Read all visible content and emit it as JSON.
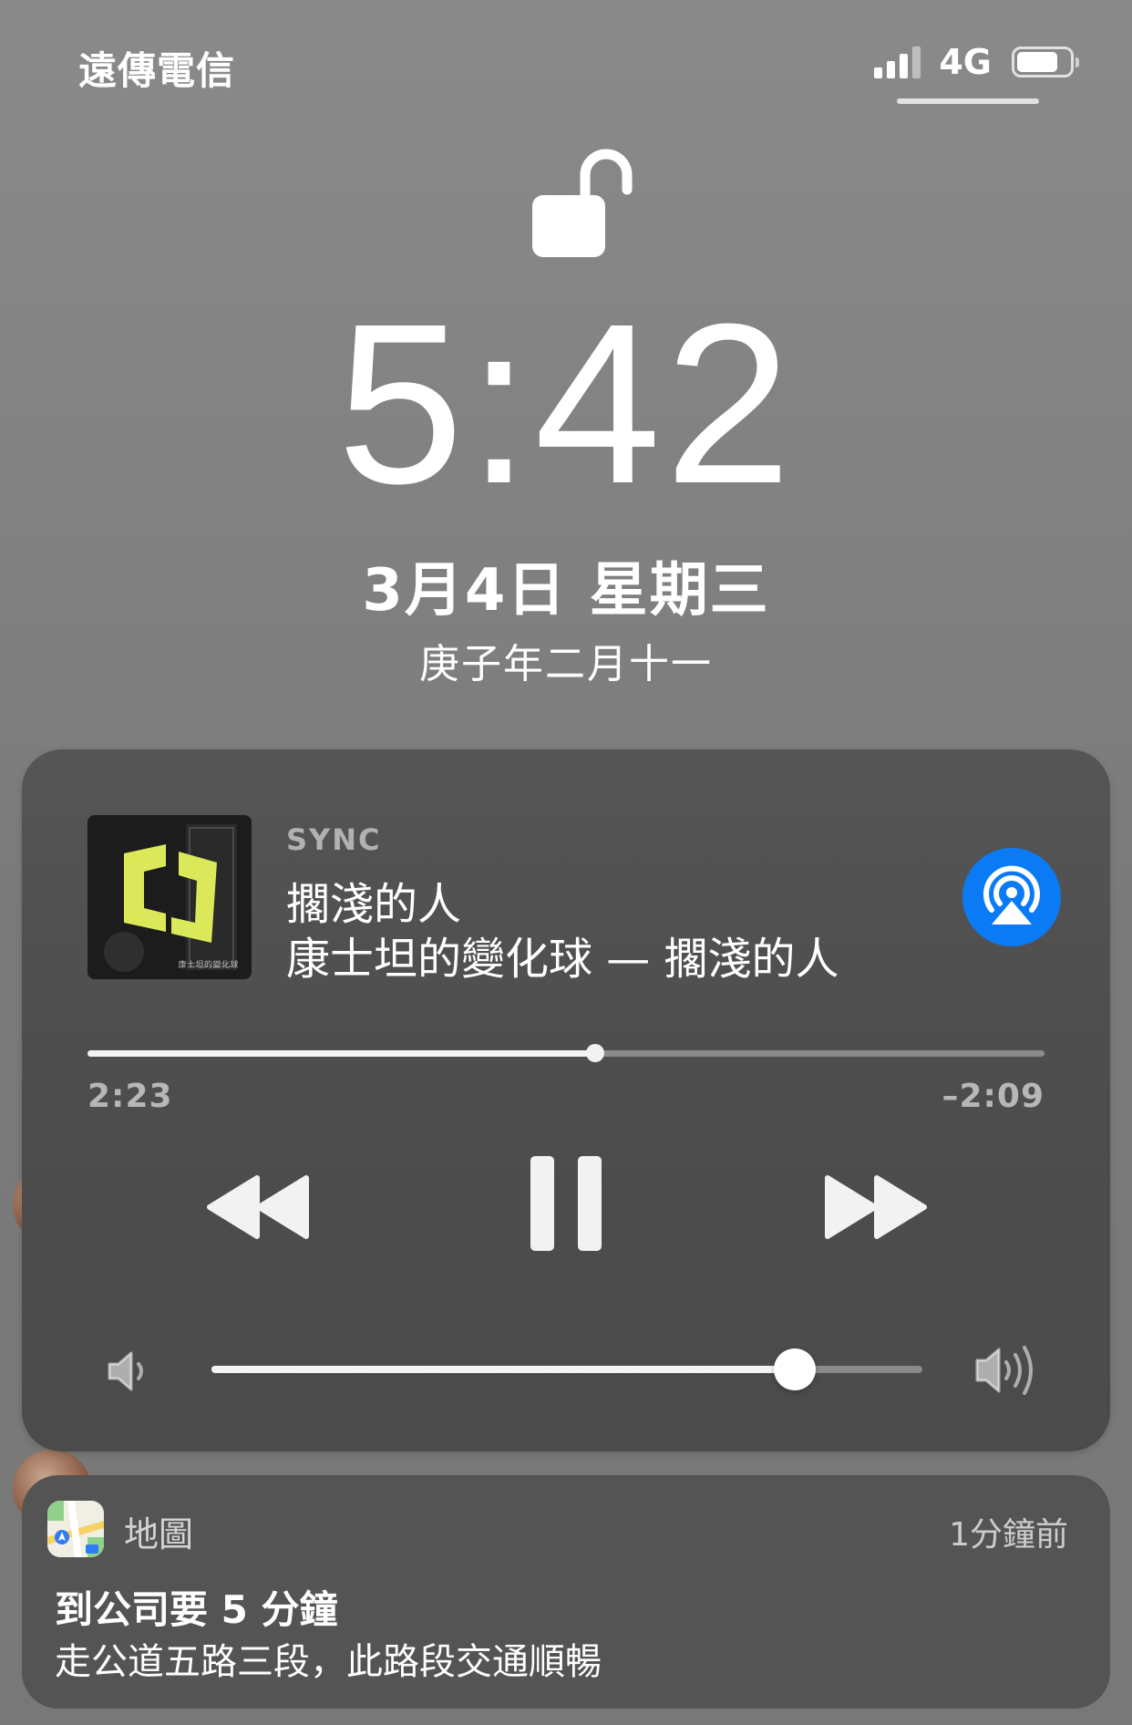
{
  "status_bar": {
    "carrier": "遠傳電信",
    "network": "4G",
    "battery_level": 0.8,
    "signal_bars": 3
  },
  "lock": {
    "icon": "unlocked-padlock-icon"
  },
  "clock": {
    "time": "5:42",
    "date": "3月4日 星期三",
    "lunar_date": "庚子年二月十一"
  },
  "now_playing": {
    "source": "SYNC",
    "title": "擱淺的人",
    "subtitle": "康士坦的變化球 — 擱淺的人",
    "artwork_text": "康士坦的變化球",
    "elapsed": "2:23",
    "remaining": "–2:09",
    "progress": 0.53,
    "volume": 0.82,
    "airplay_color": "#0a7bf5",
    "artwork_accent": "#dbe85a",
    "controls": {
      "rewind_icon": "rewind-icon",
      "pause_icon": "pause-icon",
      "forward_icon": "fast-forward-icon",
      "volume_low_icon": "speaker-low-icon",
      "volume_high_icon": "speaker-high-icon",
      "airplay_icon": "airplay-icon"
    }
  },
  "notification": {
    "app": "地圖",
    "time": "1分鐘前",
    "title": "到公司要 5 分鐘",
    "body": "走公道五路三段，此路段交通順暢",
    "app_icon": "maps-app-icon"
  }
}
